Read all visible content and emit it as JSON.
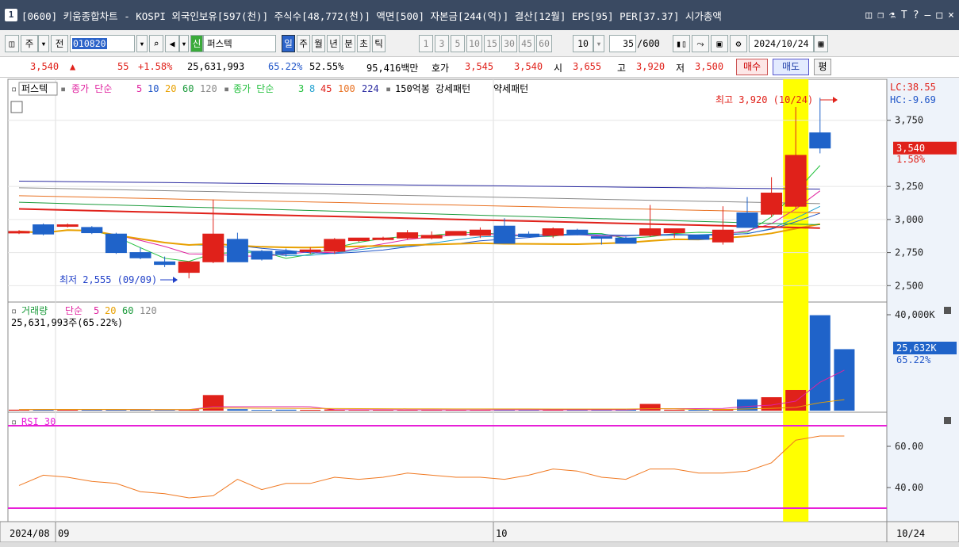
{
  "window": {
    "number": "1",
    "title": "[0600] 키움종합차트 - KOSPI 외국인보유[597(천)] 주식수[48,772(천)] 액면[500] 자본금[244(억)] 결산[12월] EPS[95] PER[37.37] 시가총액",
    "controls": [
      "◫",
      "❐",
      "⚗",
      "T",
      "?",
      "—",
      "□",
      "×"
    ]
  },
  "toolbar": {
    "market": "주",
    "mode": "전",
    "code": "010820",
    "stock_badge": "신",
    "stock_name": "퍼스텍",
    "periods": [
      "일",
      "주",
      "월",
      "년",
      "분",
      "초",
      "틱"
    ],
    "active_period": "일",
    "minutes": [
      "1",
      "3",
      "5",
      "10",
      "15",
      "30",
      "45",
      "60"
    ],
    "interval": "10",
    "count": "35",
    "count_max": "/600",
    "date": "2024/10/24"
  },
  "quote": {
    "price": "3,540",
    "arrow": "▲",
    "change": "55",
    "change_pct": "+1.58%",
    "volume": "25,631,993",
    "vol_ratio": "65.22%",
    "ratio2": "52.55%",
    "amount": "95,416백만",
    "ask_label": "호가",
    "ask": "3,545",
    "bid": "3,540",
    "open_label": "시",
    "open": "3,655",
    "high_label": "고",
    "high": "3,920",
    "low_label": "저",
    "low": "3,500",
    "buy_label": "매수",
    "sell_label": "매도",
    "eval_label": "평"
  },
  "price_panel": {
    "legend": {
      "name": "퍼스텍",
      "ma_price_label": "종가 단순",
      "ma_price": [
        "5",
        "10",
        "20",
        "60",
        "120"
      ],
      "ma_price_colors": [
        "#e0219f",
        "#1f55c8",
        "#e8a000",
        "#1a9a3a",
        "#888888"
      ],
      "ma2_label": "종가 단순",
      "ma2": [
        "3",
        "8",
        "45",
        "100",
        "224"
      ],
      "ma2_colors": [
        "#1fbf3a",
        "#1fa0d0",
        "#e0211a",
        "#e87020",
        "#2a2aa0"
      ],
      "pattern_label": "150억봉 강세패턴",
      "pattern2": "약세패턴"
    },
    "lc": "LC:38.55",
    "hc": "HC:-9.69",
    "current_tag": "3,540",
    "current_pct": "1.58%",
    "high_note": "최고 3,920 (10/24)",
    "low_note": "최저 2,555 (09/09)"
  },
  "volume_panel": {
    "legend_label": "거래량",
    "ma_label": "단순",
    "ma": [
      "5",
      "20",
      "60",
      "120"
    ],
    "ma_colors": [
      "#e0219f",
      "#e8a000",
      "#1a9a3a",
      "#888888"
    ],
    "value_line": "25,631,993주(65.22%)",
    "tag": "25,632K",
    "tag_pct": "65.22%"
  },
  "rsi_panel": {
    "label": "RSI 30"
  },
  "xaxis": {
    "labels": [
      "2024/08",
      "09",
      "10"
    ],
    "right_label": "10/24"
  },
  "chart_data": {
    "type": "candlestick",
    "price_axis": {
      "min": 2400,
      "max": 4000,
      "ticks": [
        3750,
        3250,
        3000,
        2750,
        2500
      ],
      "tick_labels": [
        "3,750",
        "3,250",
        "3,000",
        "2,750",
        "2,500"
      ]
    },
    "volume_axis": {
      "min": 0,
      "max": 40000,
      "ticks": [
        40000
      ],
      "tick_labels": [
        "40,000K"
      ]
    },
    "rsi_axis": {
      "min": 25,
      "max": 75,
      "ticks": [
        60,
        40
      ],
      "tick_labels": [
        "60.00",
        "40.00"
      ],
      "bounds": [
        70,
        30
      ]
    },
    "candles": [
      {
        "o": 2900,
        "h": 2920,
        "l": 2890,
        "c": 2910
      },
      {
        "o": 2960,
        "h": 2970,
        "l": 2880,
        "c": 2890
      },
      {
        "o": 2950,
        "h": 2970,
        "l": 2940,
        "c": 2960
      },
      {
        "o": 2940,
        "h": 2950,
        "l": 2890,
        "c": 2900
      },
      {
        "o": 2890,
        "h": 2900,
        "l": 2740,
        "c": 2750
      },
      {
        "o": 2750,
        "h": 2790,
        "l": 2700,
        "c": 2710
      },
      {
        "o": 2680,
        "h": 2720,
        "l": 2640,
        "c": 2660
      },
      {
        "o": 2600,
        "h": 2680,
        "l": 2555,
        "c": 2680
      },
      {
        "o": 2680,
        "h": 3150,
        "l": 2670,
        "c": 2890
      },
      {
        "o": 2850,
        "h": 2900,
        "l": 2680,
        "c": 2680
      },
      {
        "o": 2760,
        "h": 2770,
        "l": 2690,
        "c": 2700
      },
      {
        "o": 2760,
        "h": 2780,
        "l": 2720,
        "c": 2740
      },
      {
        "o": 2760,
        "h": 2790,
        "l": 2740,
        "c": 2770
      },
      {
        "o": 2760,
        "h": 2860,
        "l": 2740,
        "c": 2850
      },
      {
        "o": 2840,
        "h": 2860,
        "l": 2830,
        "c": 2860
      },
      {
        "o": 2850,
        "h": 2870,
        "l": 2840,
        "c": 2860
      },
      {
        "o": 2860,
        "h": 2920,
        "l": 2850,
        "c": 2900
      },
      {
        "o": 2860,
        "h": 2910,
        "l": 2850,
        "c": 2880
      },
      {
        "o": 2880,
        "h": 2910,
        "l": 2880,
        "c": 2910
      },
      {
        "o": 2880,
        "h": 2940,
        "l": 2860,
        "c": 2920
      },
      {
        "o": 2950,
        "h": 3010,
        "l": 2820,
        "c": 2820
      },
      {
        "o": 2890,
        "h": 2910,
        "l": 2870,
        "c": 2870
      },
      {
        "o": 2880,
        "h": 2940,
        "l": 2860,
        "c": 2930
      },
      {
        "o": 2920,
        "h": 2930,
        "l": 2880,
        "c": 2890
      },
      {
        "o": 2870,
        "h": 2870,
        "l": 2810,
        "c": 2860
      },
      {
        "o": 2860,
        "h": 2870,
        "l": 2820,
        "c": 2820
      },
      {
        "o": 2880,
        "h": 3110,
        "l": 2870,
        "c": 2930
      },
      {
        "o": 2900,
        "h": 2920,
        "l": 2860,
        "c": 2930
      },
      {
        "o": 2880,
        "h": 2880,
        "l": 2850,
        "c": 2850
      },
      {
        "o": 2830,
        "h": 3100,
        "l": 2810,
        "c": 2920
      },
      {
        "o": 3050,
        "h": 3170,
        "l": 2940,
        "c": 2940
      },
      {
        "o": 3040,
        "h": 3320,
        "l": 3020,
        "c": 3200
      },
      {
        "o": 3100,
        "h": 3850,
        "l": 3080,
        "c": 3485
      },
      {
        "o": 3655,
        "h": 3920,
        "l": 3500,
        "c": 3540
      }
    ],
    "volume": [
      400,
      500,
      450,
      400,
      500,
      350,
      400,
      450,
      6500,
      600,
      300,
      400,
      350,
      500,
      250,
      300,
      250,
      300,
      300,
      350,
      400,
      350,
      300,
      250,
      300,
      350,
      2800,
      400,
      350,
      600,
      4700,
      5600,
      8600,
      39800,
      25632
    ],
    "rsi": [
      41,
      46,
      45,
      43,
      42,
      38,
      37,
      35,
      36,
      44,
      39,
      42,
      42,
      45,
      44,
      45,
      47,
      46,
      45,
      45,
      44,
      46,
      49,
      48,
      45,
      44,
      49,
      49,
      47,
      47,
      48,
      52,
      63,
      65,
      65
    ]
  }
}
